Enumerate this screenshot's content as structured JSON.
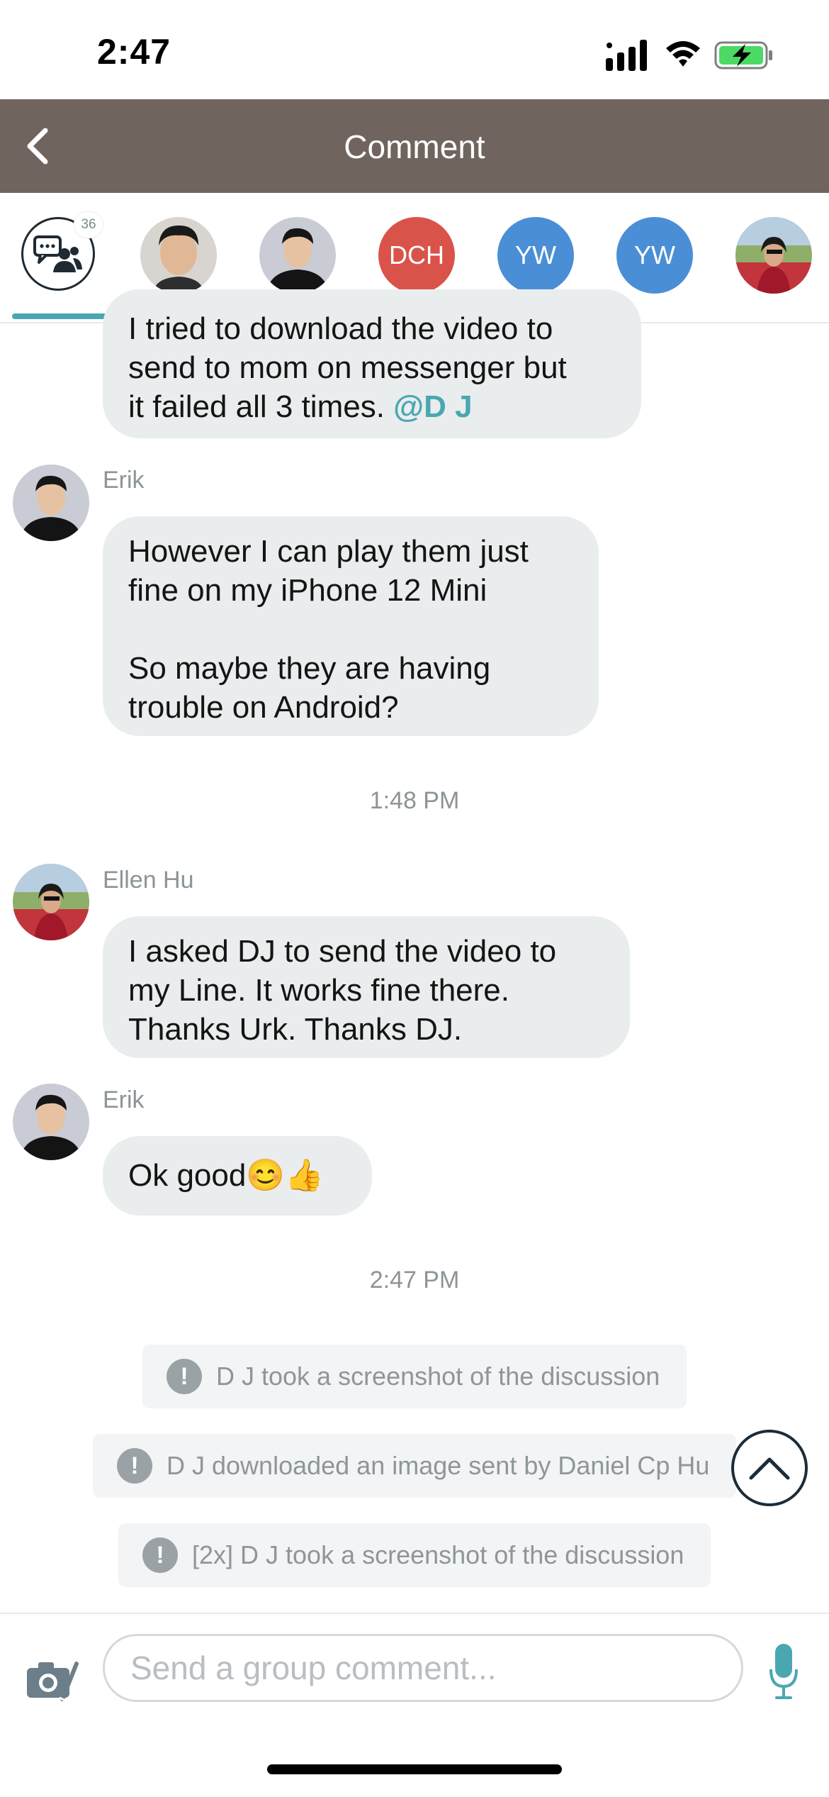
{
  "status_bar": {
    "time": "2:47"
  },
  "nav": {
    "title": "Comment"
  },
  "participants": {
    "all_badge": "36",
    "items": [
      {
        "kind": "photo",
        "name": "participant-1"
      },
      {
        "kind": "photo",
        "name": "participant-2"
      },
      {
        "initials": "DCH",
        "color": "#d9534a"
      },
      {
        "initials": "YW",
        "color": "#4a8fd6"
      },
      {
        "initials": "YW",
        "color": "#4a8fd6"
      },
      {
        "kind": "photo",
        "name": "participant-6"
      }
    ]
  },
  "messages": {
    "m0": {
      "line1": "I tried to download the video to",
      "line2": "send to mom on messenger but",
      "line3": "it failed all 3 times.",
      "mention": "@D J"
    },
    "m1": {
      "sender": "Erik",
      "p1a": "However I can play them just",
      "p1b": "fine on my iPhone 12 Mini",
      "p2a": "So maybe they are having",
      "p2b": "trouble on Android?"
    },
    "t1": "1:48 PM",
    "m2": {
      "sender": "Ellen Hu",
      "line1": "I asked DJ to send the video to",
      "line2": "my Line. It works fine there.",
      "line3": "Thanks Urk. Thanks DJ."
    },
    "m3": {
      "sender": "Erik",
      "text": "Ok good😊👍"
    },
    "t2": "2:47 PM"
  },
  "system": {
    "s1": "D J took a screenshot of the discussion",
    "s2": "D J downloaded an image sent by Daniel Cp Hu",
    "s3": "[2x] D J took a screenshot of the discussion"
  },
  "composer": {
    "placeholder": "Send a group comment..."
  },
  "colors": {
    "nav": "#70645f",
    "accent": "#4aa7b2",
    "bubble": "#e9eded"
  }
}
